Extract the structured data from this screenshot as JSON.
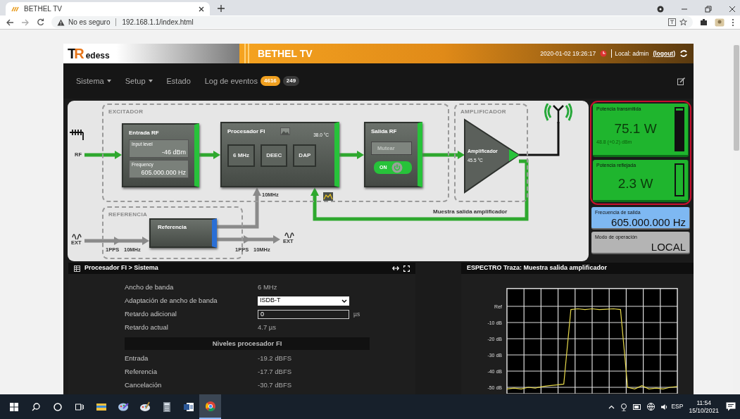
{
  "browser": {
    "tab_title": "BETHEL TV",
    "security_label": "No es seguro",
    "url": "192.168.1.1/index.html"
  },
  "header": {
    "logo": {
      "letter_1": "T",
      "letter_2": "R",
      "text": "edess"
    },
    "title": "BETHEL TV",
    "datetime": "2020-01-02 19:26:17",
    "user": "Local: admin",
    "logout": "(logout)"
  },
  "nav": [
    {
      "label": "Sistema",
      "dropdown": true
    },
    {
      "label": "Setup",
      "dropdown": true
    },
    {
      "label": "Estado",
      "dropdown": false
    },
    {
      "label": "Log de eventos",
      "dropdown": false,
      "badges": [
        {
          "text": "4616",
          "color": "#f0a020"
        },
        {
          "text": "249",
          "color": "#3a3a3a"
        }
      ]
    }
  ],
  "diagram": {
    "groups": [
      {
        "label": "EXCITADOR"
      },
      {
        "label": "AMPLIFICADOR"
      },
      {
        "label": "REFERENCIA"
      }
    ],
    "rf_label": "RF",
    "entrada_rf": {
      "title": "Entrada RF",
      "fields": [
        {
          "label": "Input level",
          "value": "-46 dBm"
        },
        {
          "label": "Frequency",
          "value": "605.000.000 Hz"
        }
      ]
    },
    "procesador": {
      "title": "Procesador FI",
      "temperature": "38.0 °C",
      "buttons": [
        "6 MHz",
        "DEEC",
        "DAP"
      ]
    },
    "salida_rf": {
      "title": "Salida RF",
      "mute_button": "Mutear",
      "toggle": {
        "label": "ON",
        "on": true
      }
    },
    "amplificador": {
      "title": "Amplificador",
      "temperature": "45.5 °C"
    },
    "feedback_label": "Muestra salida amplificador",
    "clock_label": "10MHz",
    "referencia": {
      "title": "Referencia",
      "input_labels": [
        "1PPS",
        "10MHz"
      ],
      "output_labels": [
        "1PPS",
        "10MHz"
      ],
      "ext_in": "EXT",
      "ext_out": "EXT"
    }
  },
  "status_tiles": [
    {
      "kind": "power",
      "title": "Potencia transmitida",
      "value": "75.1 W",
      "detail": "48.8 (+0.2) dBm",
      "level": 0.95,
      "color": "#1fb52e",
      "highlighted": true
    },
    {
      "kind": "power",
      "title": "Potencia reflejada",
      "value": "2.3 W",
      "level": 0,
      "color": "#1fb52e",
      "highlighted": true
    },
    {
      "kind": "info",
      "title": "Frecuencia de salida",
      "value": "605.000.000 Hz",
      "color": "#7eb8f2",
      "highlighted": false
    },
    {
      "kind": "info",
      "title": "Modo de operación",
      "value": "LOCAL",
      "color": "#b4b4b4",
      "highlighted": false
    }
  ],
  "system_panel": {
    "title": "Procesador FI > Sistema",
    "rows": [
      {
        "kind": "value",
        "label": "Ancho de banda",
        "value": "6 MHz"
      },
      {
        "kind": "select",
        "label": "Adaptación de ancho de banda",
        "value": "ISDB-T"
      },
      {
        "kind": "input",
        "label": "Retardo adicional",
        "value": "0",
        "unit": "µs"
      },
      {
        "kind": "value",
        "label": "Retardo actual",
        "value": "4.7 µs"
      },
      {
        "kind": "section",
        "label": "Niveles procesador FI"
      },
      {
        "kind": "value",
        "label": "Entrada",
        "value": "-19.2 dBFS"
      },
      {
        "kind": "value",
        "label": "Referencia",
        "value": "-17.7 dBFS"
      },
      {
        "kind": "value",
        "label": "Cancelación",
        "value": "-30.7 dBFS"
      }
    ]
  },
  "spectrum_panel": {
    "title": "ESPECTRO Traza: Muestra salida amplificador",
    "chart_data": {
      "type": "line",
      "grid": true,
      "ylim": [
        -54,
        11
      ],
      "yticks": [
        {
          "value": 0,
          "label": "Ref"
        },
        {
          "value": -10,
          "label": "-10 dB"
        },
        {
          "value": -20,
          "label": "-20 dB"
        },
        {
          "value": -30,
          "label": "-30 dB"
        },
        {
          "value": -40,
          "label": "-40 dB"
        },
        {
          "value": -50,
          "label": "-50 dB"
        }
      ],
      "series": [
        {
          "color": "#e6d84a",
          "values": [
            -51,
            -50.5,
            -51,
            -50,
            -50.5,
            -49.5,
            -49,
            -48.5,
            -48,
            -2,
            -1.5,
            -2,
            -1.5,
            -2,
            -1.8,
            -1.5,
            -2,
            -50,
            -51,
            -49,
            -51,
            -50.5,
            -51,
            -50,
            -49.5
          ]
        }
      ]
    }
  },
  "taskbar": {
    "apps": [
      {
        "kind": "explorer",
        "selected": false
      },
      {
        "kind": "paint3d",
        "selected": false
      },
      {
        "kind": "paint",
        "selected": false
      },
      {
        "kind": "calculator",
        "selected": false
      },
      {
        "kind": "word",
        "selected": false
      },
      {
        "kind": "chrome",
        "selected": true
      }
    ],
    "language": "ESP",
    "time": "11:54",
    "date": "15/10/2021"
  }
}
